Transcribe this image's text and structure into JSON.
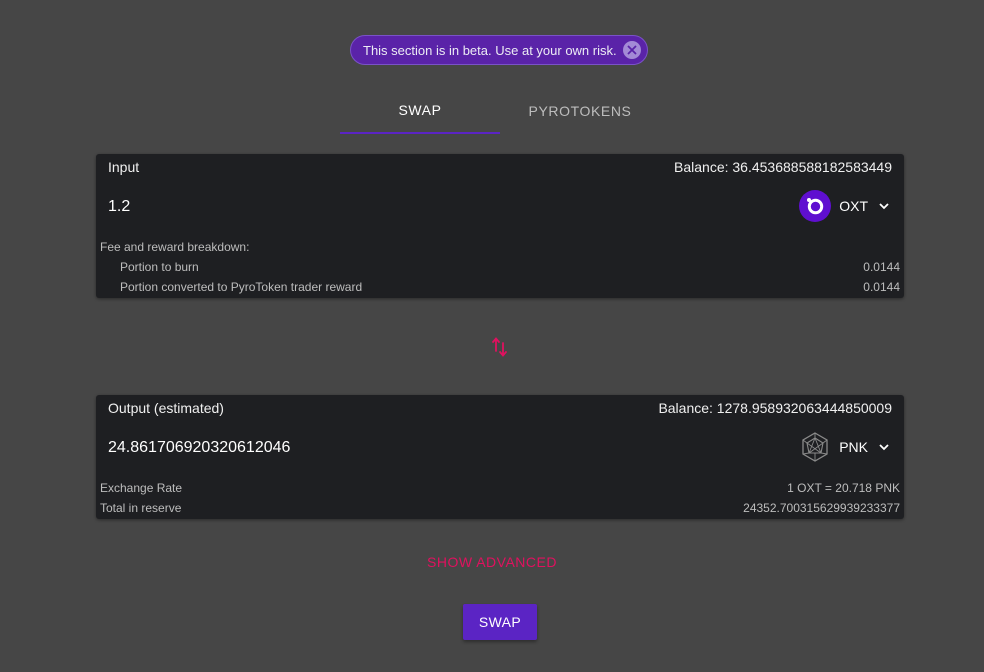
{
  "beta_banner": {
    "text": "This section is in beta. Use at your own risk."
  },
  "tabs": [
    {
      "label": "SWAP",
      "active": true
    },
    {
      "label": "PYROTOKENS",
      "active": false
    }
  ],
  "input": {
    "label": "Input",
    "balance": "Balance: 36.453688588182583449",
    "amount": "1.2",
    "token": {
      "symbol": "OXT",
      "icon": "orchid-logo-icon",
      "color": "#5f0fd0"
    },
    "breakdown_title": "Fee and reward breakdown:",
    "breakdown": [
      {
        "label": "Portion to burn",
        "value": "0.0144"
      },
      {
        "label": "Portion converted to PyroToken trader reward",
        "value": "0.0144"
      }
    ]
  },
  "output": {
    "label": "Output (estimated)",
    "balance": "Balance: 1278.958932063444850009",
    "amount": "24.861706920320612046",
    "token": {
      "symbol": "PNK",
      "icon": "kleros-logo-icon"
    },
    "details": [
      {
        "label": "Exchange Rate",
        "value": "1 OXT = 20.718 PNK"
      },
      {
        "label": "Total in reserve",
        "value": "24352.700315629939233377"
      }
    ]
  },
  "show_advanced_label": "SHOW ADVANCED",
  "swap_button_label": "SWAP",
  "colors": {
    "background": "#464646",
    "card": "#1e1f22",
    "accent": "#5b24c4",
    "link": "#e0115f"
  }
}
